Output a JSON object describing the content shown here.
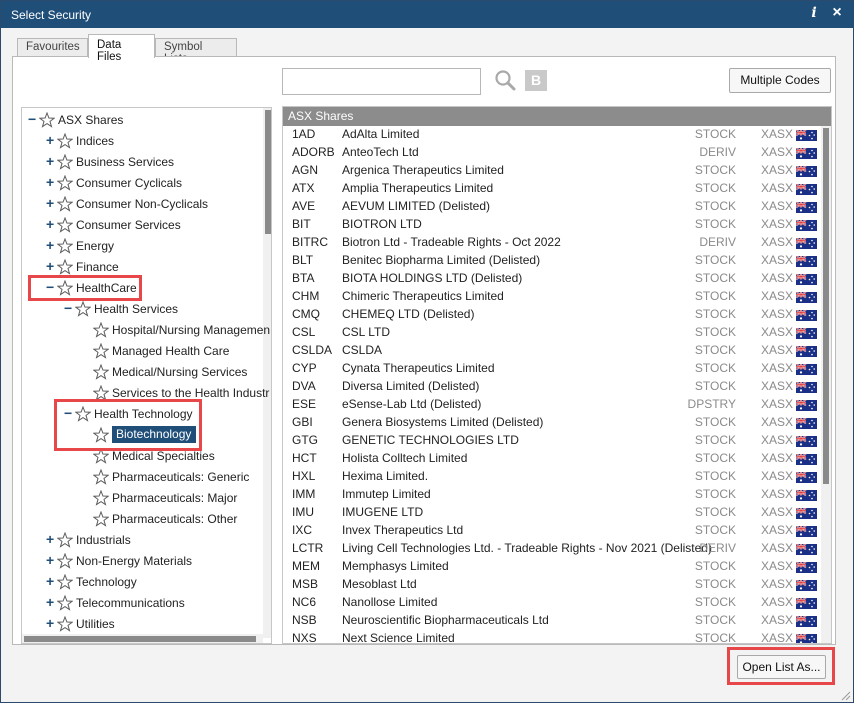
{
  "window": {
    "title": "Select Security",
    "info_label": "i",
    "close_label": "×"
  },
  "tabs": [
    {
      "label": "Favourites",
      "active": false
    },
    {
      "label": "Data Files",
      "active": true
    },
    {
      "label": "Symbol Lists",
      "active": false
    }
  ],
  "search": {
    "value": "",
    "placeholder": "",
    "icon": "search-icon",
    "browse_label": "B"
  },
  "multiple_codes_label": "Multiple Codes",
  "open_list_label": "Open List As...",
  "colors": {
    "titlebar": "#1f4e79",
    "header": "#8c8c8c",
    "selection": "#1f4e79",
    "highlight": "#e8474a",
    "muted": "#8a8a8a"
  },
  "tree": {
    "nodes": [
      {
        "label": "ASX Shares",
        "level": 0,
        "expander": "−",
        "selected": false
      },
      {
        "label": "Indices",
        "level": 1,
        "expander": "+",
        "selected": false
      },
      {
        "label": "Business Services",
        "level": 1,
        "expander": "+",
        "selected": false
      },
      {
        "label": "Consumer Cyclicals",
        "level": 1,
        "expander": "+",
        "selected": false
      },
      {
        "label": "Consumer Non-Cyclicals",
        "level": 1,
        "expander": "+",
        "selected": false
      },
      {
        "label": "Consumer Services",
        "level": 1,
        "expander": "+",
        "selected": false
      },
      {
        "label": "Energy",
        "level": 1,
        "expander": "+",
        "selected": false
      },
      {
        "label": "Finance",
        "level": 1,
        "expander": "+",
        "selected": false
      },
      {
        "label": "HealthCare",
        "level": 1,
        "expander": "−",
        "selected": false
      },
      {
        "label": "Health Services",
        "level": 2,
        "expander": "−",
        "selected": false
      },
      {
        "label": "Hospital/Nursing Managemen",
        "level": 3,
        "expander": "",
        "selected": false
      },
      {
        "label": "Managed Health Care",
        "level": 3,
        "expander": "",
        "selected": false
      },
      {
        "label": "Medical/Nursing Services",
        "level": 3,
        "expander": "",
        "selected": false
      },
      {
        "label": "Services to the Health Industr",
        "level": 3,
        "expander": "",
        "selected": false
      },
      {
        "label": "Health Technology",
        "level": 2,
        "expander": "−",
        "selected": false
      },
      {
        "label": "Biotechnology",
        "level": 3,
        "expander": "",
        "selected": true
      },
      {
        "label": "Medical Specialties",
        "level": 3,
        "expander": "",
        "selected": false
      },
      {
        "label": "Pharmaceuticals: Generic",
        "level": 3,
        "expander": "",
        "selected": false
      },
      {
        "label": "Pharmaceuticals: Major",
        "level": 3,
        "expander": "",
        "selected": false
      },
      {
        "label": "Pharmaceuticals: Other",
        "level": 3,
        "expander": "",
        "selected": false
      },
      {
        "label": "Industrials",
        "level": 1,
        "expander": "+",
        "selected": false
      },
      {
        "label": "Non-Energy Materials",
        "level": 1,
        "expander": "+",
        "selected": false
      },
      {
        "label": "Technology",
        "level": 1,
        "expander": "+",
        "selected": false
      },
      {
        "label": "Telecommunications",
        "level": 1,
        "expander": "+",
        "selected": false
      },
      {
        "label": "Utilities",
        "level": 1,
        "expander": "+",
        "selected": false
      }
    ]
  },
  "list": {
    "header": "ASX Shares",
    "rows": [
      {
        "code": "1AD",
        "name": "AdAlta Limited",
        "type": "STOCK",
        "exchange": "XASX"
      },
      {
        "code": "ADORB",
        "name": "AnteoTech Ltd",
        "type": "DERIV",
        "exchange": "XASX"
      },
      {
        "code": "AGN",
        "name": "Argenica Therapeutics Limited",
        "type": "STOCK",
        "exchange": "XASX"
      },
      {
        "code": "ATX",
        "name": "Amplia Therapeutics Limited",
        "type": "STOCK",
        "exchange": "XASX"
      },
      {
        "code": "AVE",
        "name": "AEVUM LIMITED (Delisted)",
        "type": "STOCK",
        "exchange": "XASX"
      },
      {
        "code": "BIT",
        "name": "BIOTRON LTD",
        "type": "STOCK",
        "exchange": "XASX"
      },
      {
        "code": "BITRC",
        "name": "Biotron Ltd - Tradeable Rights - Oct 2022",
        "type": "DERIV",
        "exchange": "XASX"
      },
      {
        "code": "BLT",
        "name": "Benitec Biopharma Limited (Delisted)",
        "type": "STOCK",
        "exchange": "XASX"
      },
      {
        "code": "BTA",
        "name": "BIOTA HOLDINGS LTD (Delisted)",
        "type": "STOCK",
        "exchange": "XASX"
      },
      {
        "code": "CHM",
        "name": "Chimeric Therapeutics Limited",
        "type": "STOCK",
        "exchange": "XASX"
      },
      {
        "code": "CMQ",
        "name": "CHEMEQ LTD (Delisted)",
        "type": "STOCK",
        "exchange": "XASX"
      },
      {
        "code": "CSL",
        "name": "CSL LTD",
        "type": "STOCK",
        "exchange": "XASX"
      },
      {
        "code": "CSLDA",
        "name": "CSLDA",
        "type": "STOCK",
        "exchange": "XASX"
      },
      {
        "code": "CYP",
        "name": "Cynata Therapeutics Limited",
        "type": "STOCK",
        "exchange": "XASX"
      },
      {
        "code": "DVA",
        "name": "Diversa Limited (Delisted)",
        "type": "STOCK",
        "exchange": "XASX"
      },
      {
        "code": "ESE",
        "name": "eSense-Lab Ltd (Delisted)",
        "type": "DPSTRY",
        "exchange": "XASX"
      },
      {
        "code": "GBI",
        "name": "Genera Biosystems Limited (Delisted)",
        "type": "STOCK",
        "exchange": "XASX"
      },
      {
        "code": "GTG",
        "name": "GENETIC TECHNOLOGIES LTD",
        "type": "STOCK",
        "exchange": "XASX"
      },
      {
        "code": "HCT",
        "name": "Holista Colltech Limited",
        "type": "STOCK",
        "exchange": "XASX"
      },
      {
        "code": "HXL",
        "name": "Hexima Limited.",
        "type": "STOCK",
        "exchange": "XASX"
      },
      {
        "code": "IMM",
        "name": "Immutep Limited",
        "type": "STOCK",
        "exchange": "XASX"
      },
      {
        "code": "IMU",
        "name": "IMUGENE LTD",
        "type": "STOCK",
        "exchange": "XASX"
      },
      {
        "code": "IXC",
        "name": "Invex Therapeutics Ltd",
        "type": "STOCK",
        "exchange": "XASX"
      },
      {
        "code": "LCTR",
        "name": "Living Cell Technologies Ltd. - Tradeable Rights - Nov 2021 (Delisted)",
        "type": "DERIV",
        "exchange": "XASX"
      },
      {
        "code": "MEM",
        "name": "Memphasys Limited",
        "type": "STOCK",
        "exchange": "XASX"
      },
      {
        "code": "MSB",
        "name": "Mesoblast Ltd",
        "type": "STOCK",
        "exchange": "XASX"
      },
      {
        "code": "NC6",
        "name": "Nanollose Limited",
        "type": "STOCK",
        "exchange": "XASX"
      },
      {
        "code": "NSB",
        "name": "Neuroscientific Biopharmaceuticals Ltd",
        "type": "STOCK",
        "exchange": "XASX"
      },
      {
        "code": "NXS",
        "name": "Next Science Limited",
        "type": "STOCK",
        "exchange": "XASX"
      }
    ]
  }
}
